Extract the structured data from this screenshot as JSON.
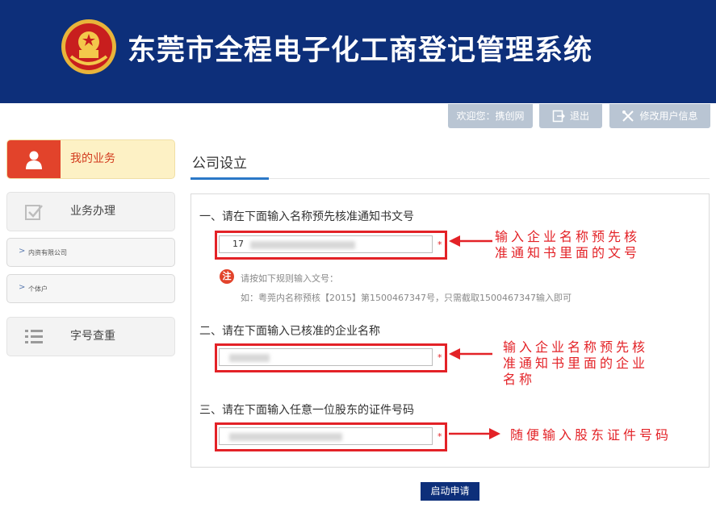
{
  "header": {
    "title": "东莞市全程电子化工商登记管理系统"
  },
  "topbar": {
    "welcome": "欢迎您：携创网",
    "logout": "退出",
    "edit_user": "修改用户信息"
  },
  "sidebar": {
    "my_business": "我的业务",
    "business_handling": "业务办理",
    "sub_items": [
      "内资有限公司",
      "个体户"
    ],
    "name_check": "字号查重"
  },
  "main": {
    "title": "公司设立",
    "step1": {
      "label": "一、请在下面输入名称预先核准通知书文号",
      "value": "17"
    },
    "note": {
      "icon": "注",
      "line1": "请按如下规则输入文号：",
      "line2": "如：粤莞内名称预核【2015】第1500467347号，只需截取1500467347输入即可"
    },
    "step2": {
      "label": "二、请在下面输入已核准的企业名称"
    },
    "step3": {
      "label": "三、请在下面输入任意一位股东的证件号码"
    },
    "required_mark": "*",
    "submit": "启动申请"
  },
  "annotations": {
    "a1_line1": "输入企业名称预先核",
    "a1_line2": "准通知书里面的文号",
    "a2_line1": "输入企业名称预先核",
    "a2_line2": "准通知书里面的企业",
    "a2_line3": "名称",
    "a3": "随便输入股东证件号码"
  },
  "colors": {
    "header_bg": "#0d2f7a",
    "accent_red": "#e32227",
    "active_bg": "#fdf1c5",
    "tab_accent": "#2b78c7"
  }
}
